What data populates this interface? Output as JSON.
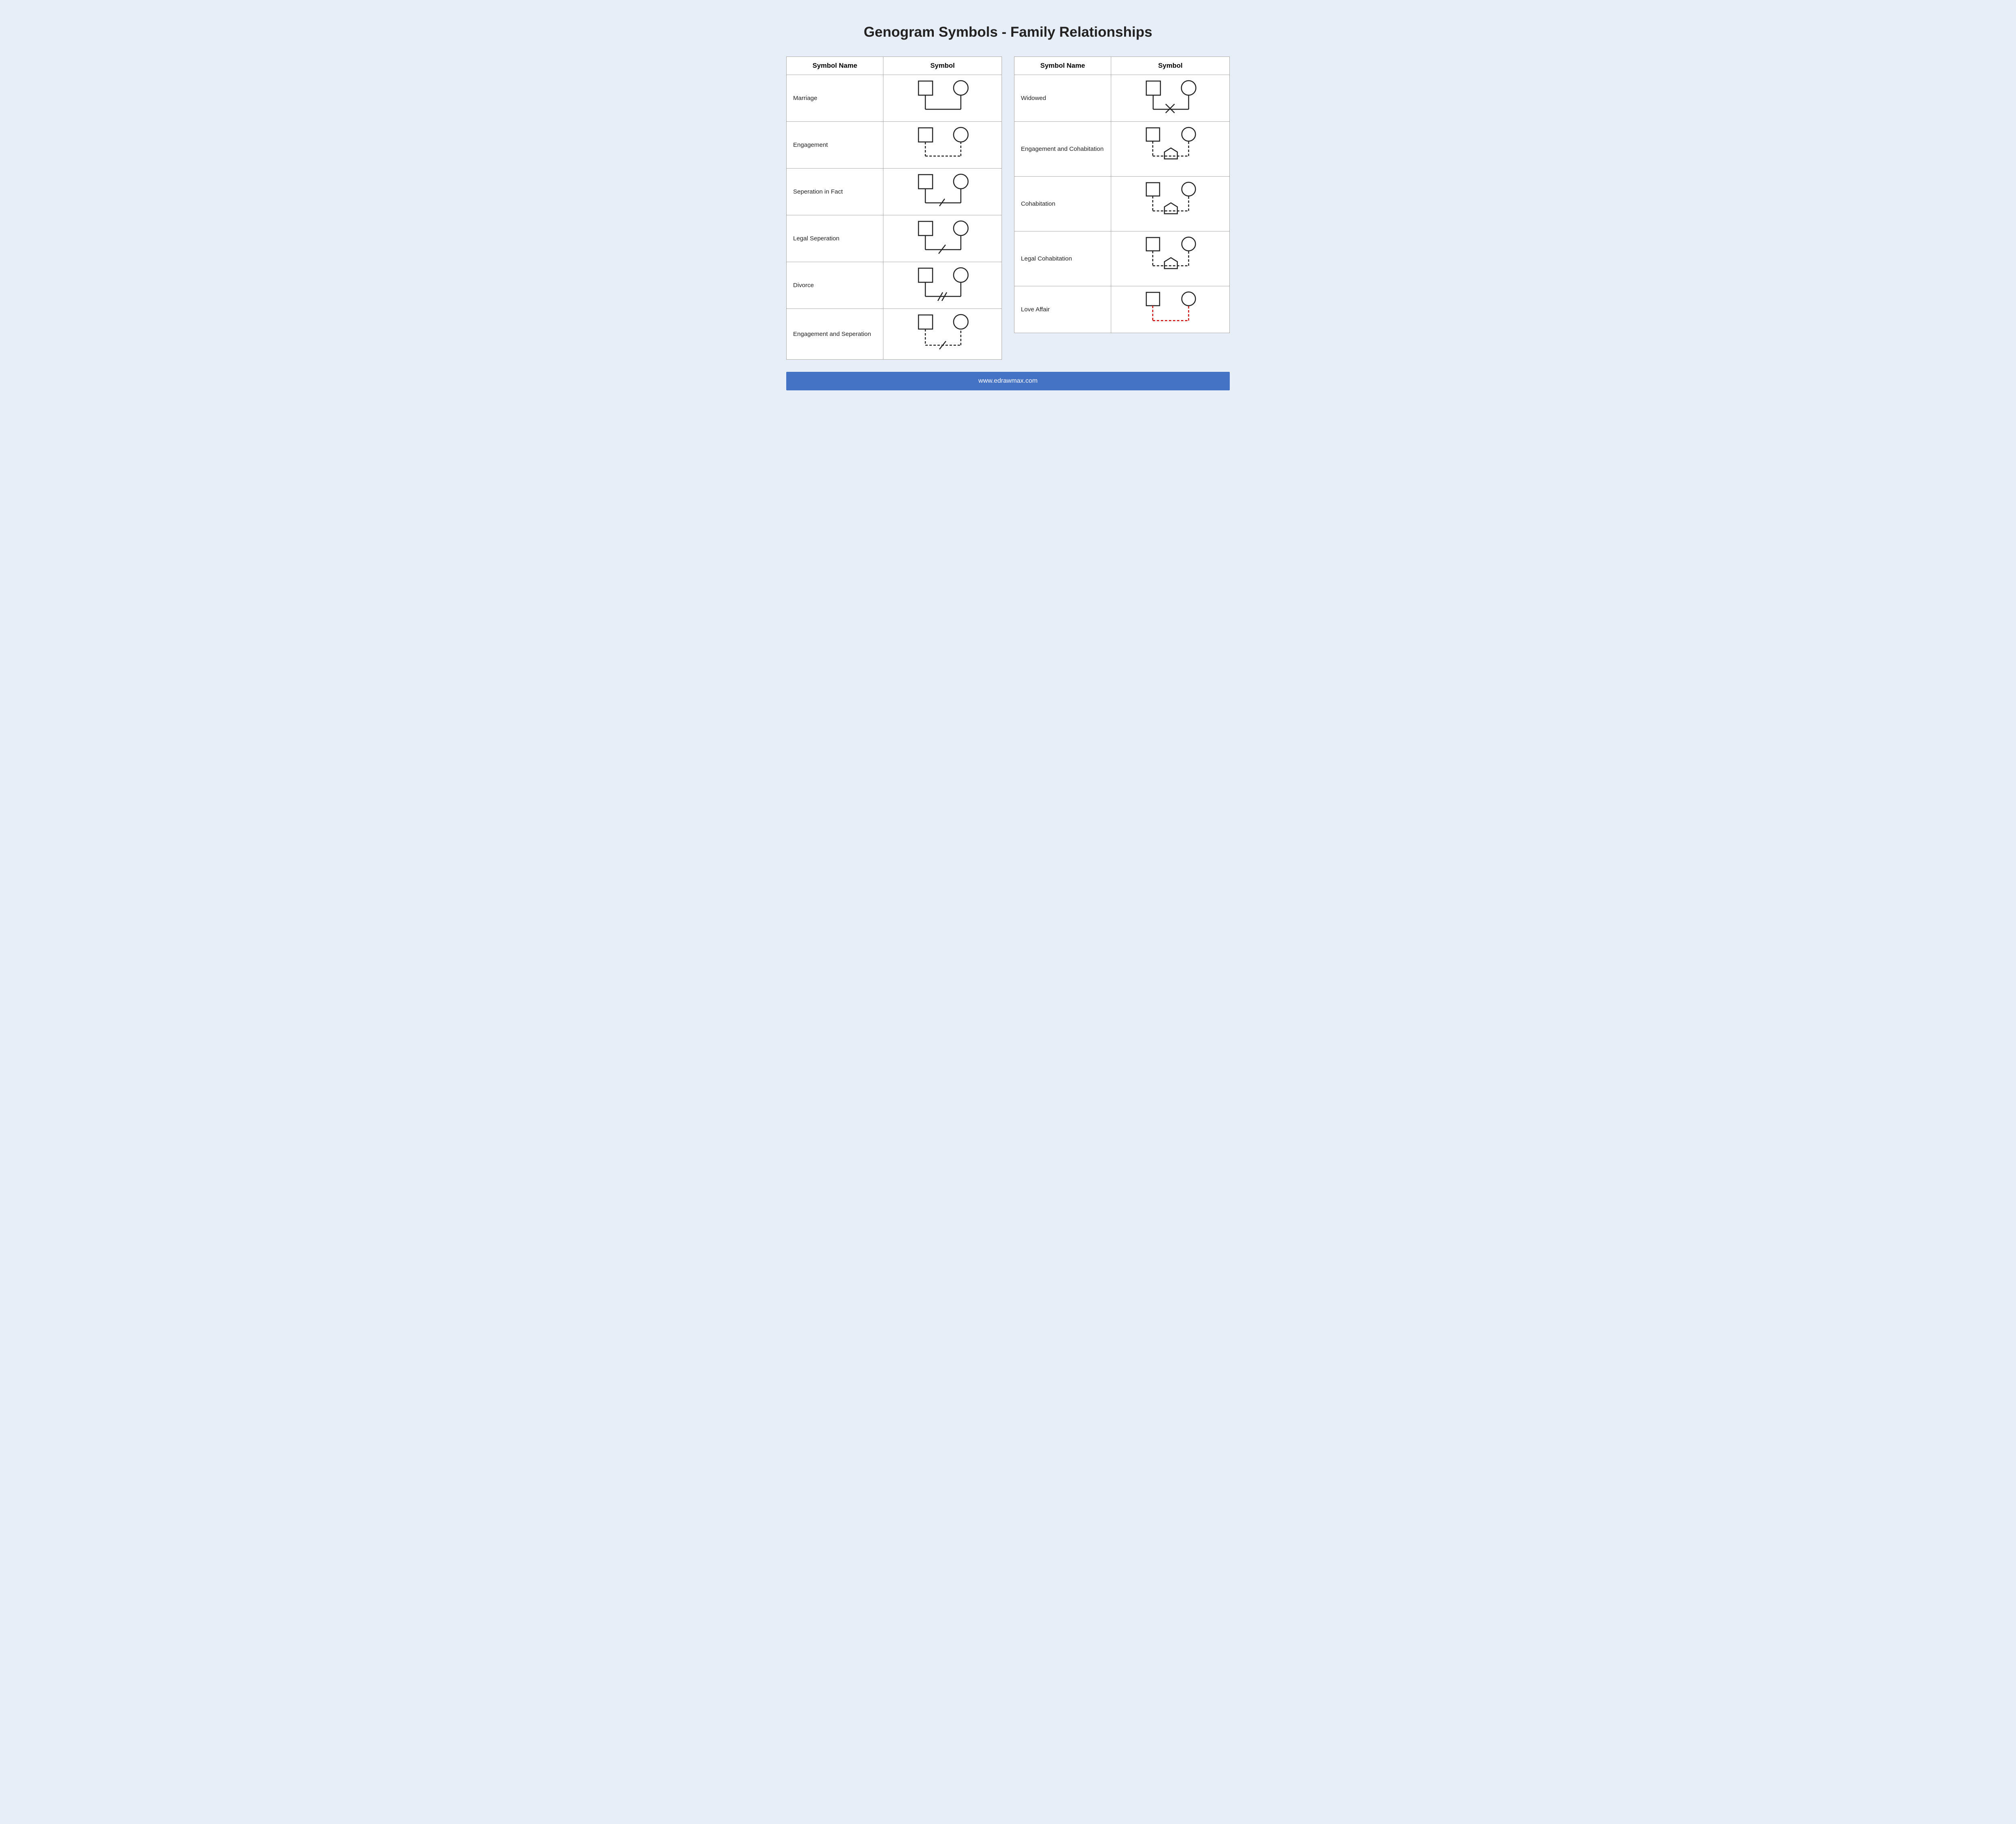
{
  "page": {
    "title": "Genogram Symbols - Family Relationships",
    "footer_url": "www.edrawmax.com"
  },
  "left_table": {
    "col1_header": "Symbol Name",
    "col2_header": "Symbol",
    "rows": [
      {
        "name": "Marriage"
      },
      {
        "name": "Engagement"
      },
      {
        "name": "Seperation in Fact"
      },
      {
        "name": "Legal Seperation"
      },
      {
        "name": "Divorce"
      },
      {
        "name": "Engagement and Seperation"
      }
    ]
  },
  "right_table": {
    "col1_header": "Symbol Name",
    "col2_header": "Symbol",
    "rows": [
      {
        "name": "Widowed"
      },
      {
        "name": "Engagement and Cohabitation"
      },
      {
        "name": "Cohabitation"
      },
      {
        "name": "Legal Cohabitation"
      },
      {
        "name": "Love Affair"
      }
    ]
  }
}
